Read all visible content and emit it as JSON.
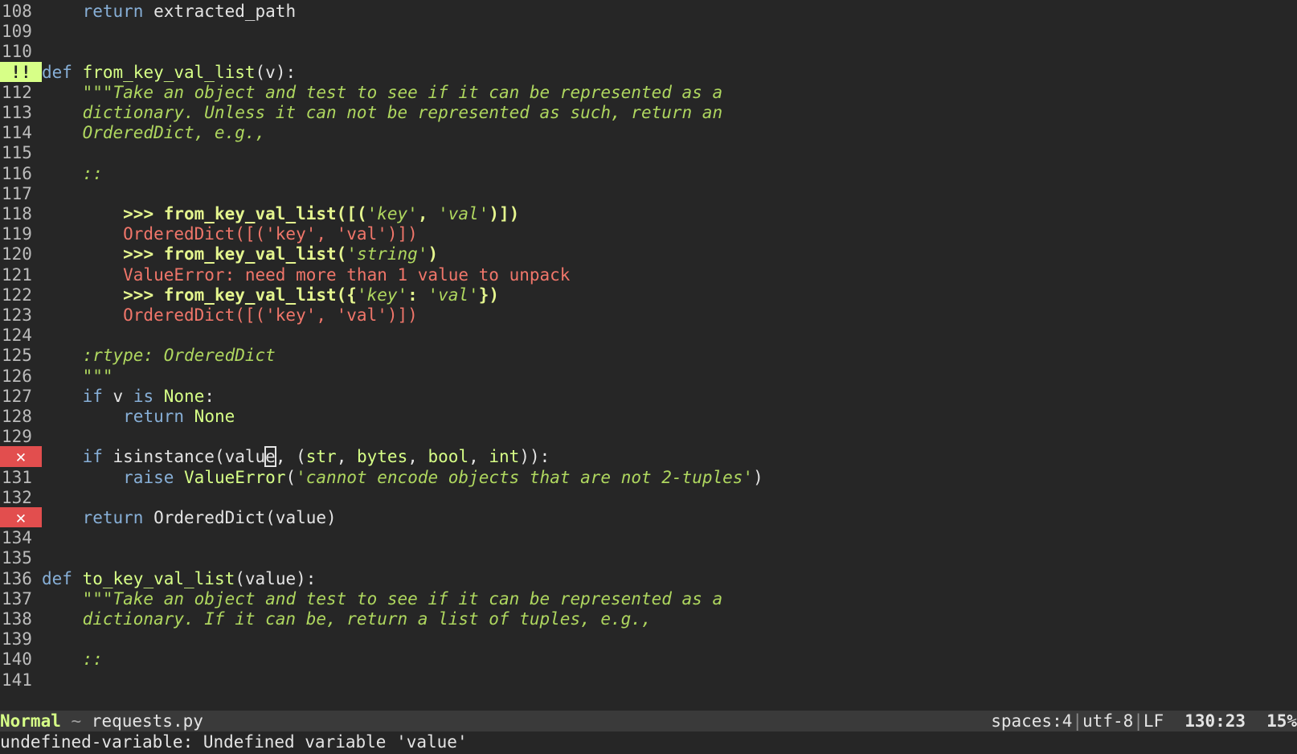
{
  "editor": {
    "lines": [
      {
        "num": "108",
        "marker": "",
        "segs": [
          [
            "plain",
            "    "
          ],
          [
            "kw",
            "return"
          ],
          [
            "plain",
            " extracted_path"
          ]
        ]
      },
      {
        "num": "109",
        "marker": "",
        "segs": []
      },
      {
        "num": "110",
        "marker": "",
        "segs": []
      },
      {
        "num": "111",
        "marker": "warn",
        "segs": [
          [
            "kw",
            "def"
          ],
          [
            "plain",
            " "
          ],
          [
            "fn",
            "from_key_val_list"
          ],
          [
            "plain",
            "(v):"
          ]
        ]
      },
      {
        "num": "112",
        "marker": "",
        "segs": [
          [
            "plain",
            "    "
          ],
          [
            "doc",
            "\"\"\"Take an object and test to see if it can be represented as a"
          ]
        ]
      },
      {
        "num": "113",
        "marker": "",
        "segs": [
          [
            "doc",
            "    dictionary. Unless it can not be represented as such, return an"
          ]
        ]
      },
      {
        "num": "114",
        "marker": "",
        "segs": [
          [
            "doc",
            "    OrderedDict, e.g.,"
          ]
        ]
      },
      {
        "num": "115",
        "marker": "",
        "segs": []
      },
      {
        "num": "116",
        "marker": "",
        "segs": [
          [
            "doc",
            "    ::"
          ]
        ]
      },
      {
        "num": "117",
        "marker": "",
        "segs": []
      },
      {
        "num": "118",
        "marker": "",
        "segs": [
          [
            "plain",
            "        "
          ],
          [
            "doctest",
            ">>> from_key_val_list([("
          ],
          [
            "dstr",
            "'key'"
          ],
          [
            "doctest",
            ", "
          ],
          [
            "dstr",
            "'val'"
          ],
          [
            "doctest",
            ")])"
          ]
        ]
      },
      {
        "num": "119",
        "marker": "",
        "segs": [
          [
            "out",
            "        OrderedDict([('key', 'val')])"
          ]
        ]
      },
      {
        "num": "120",
        "marker": "",
        "segs": [
          [
            "plain",
            "        "
          ],
          [
            "doctest",
            ">>> from_key_val_list("
          ],
          [
            "dstr",
            "'string'"
          ],
          [
            "doctest",
            ")"
          ]
        ]
      },
      {
        "num": "121",
        "marker": "",
        "segs": [
          [
            "out",
            "        ValueError: need more than 1 value to unpack"
          ]
        ]
      },
      {
        "num": "122",
        "marker": "",
        "segs": [
          [
            "plain",
            "        "
          ],
          [
            "doctest",
            ">>> from_key_val_list({"
          ],
          [
            "dstr",
            "'key'"
          ],
          [
            "doctest",
            ": "
          ],
          [
            "dstr",
            "'val'"
          ],
          [
            "doctest",
            "})"
          ]
        ]
      },
      {
        "num": "123",
        "marker": "",
        "segs": [
          [
            "out",
            "        OrderedDict([('key', 'val')])"
          ]
        ]
      },
      {
        "num": "124",
        "marker": "",
        "segs": []
      },
      {
        "num": "125",
        "marker": "",
        "segs": [
          [
            "doc",
            "    :rtype: OrderedDict"
          ]
        ]
      },
      {
        "num": "126",
        "marker": "",
        "segs": [
          [
            "doc",
            "    \"\"\""
          ]
        ]
      },
      {
        "num": "127",
        "marker": "",
        "segs": [
          [
            "plain",
            "    "
          ],
          [
            "kw",
            "if"
          ],
          [
            "plain",
            " v "
          ],
          [
            "kw",
            "is"
          ],
          [
            "plain",
            " "
          ],
          [
            "bi",
            "None"
          ],
          [
            "plain",
            ":"
          ]
        ]
      },
      {
        "num": "128",
        "marker": "",
        "segs": [
          [
            "plain",
            "        "
          ],
          [
            "kw",
            "return"
          ],
          [
            "plain",
            " "
          ],
          [
            "bi",
            "None"
          ]
        ]
      },
      {
        "num": "129",
        "marker": "",
        "segs": []
      },
      {
        "num": "130",
        "marker": "err",
        "segs": [
          [
            "plain",
            "    "
          ],
          [
            "kw",
            "if"
          ],
          [
            "plain",
            " isinstance(valu"
          ],
          [
            "cursor",
            "e"
          ],
          [
            "plain",
            ", ("
          ],
          [
            "bi",
            "str"
          ],
          [
            "plain",
            ", "
          ],
          [
            "bi",
            "bytes"
          ],
          [
            "plain",
            ", "
          ],
          [
            "bi",
            "bool"
          ],
          [
            "plain",
            ", "
          ],
          [
            "bi",
            "int"
          ],
          [
            "plain",
            ")):"
          ]
        ]
      },
      {
        "num": "131",
        "marker": "",
        "segs": [
          [
            "plain",
            "        "
          ],
          [
            "kw",
            "raise"
          ],
          [
            "plain",
            " "
          ],
          [
            "bi",
            "ValueError"
          ],
          [
            "plain",
            "("
          ],
          [
            "str",
            "'cannot encode objects that are not 2-tuples'"
          ],
          [
            "plain",
            ")"
          ]
        ]
      },
      {
        "num": "132",
        "marker": "",
        "segs": []
      },
      {
        "num": "133",
        "marker": "err",
        "segs": [
          [
            "plain",
            "    "
          ],
          [
            "kw",
            "return"
          ],
          [
            "plain",
            " OrderedDict(value)"
          ]
        ]
      },
      {
        "num": "134",
        "marker": "",
        "segs": []
      },
      {
        "num": "135",
        "marker": "",
        "segs": []
      },
      {
        "num": "136",
        "marker": "",
        "segs": [
          [
            "kw",
            "def"
          ],
          [
            "plain",
            " "
          ],
          [
            "fn",
            "to_key_val_list"
          ],
          [
            "plain",
            "(value):"
          ]
        ]
      },
      {
        "num": "137",
        "marker": "",
        "segs": [
          [
            "plain",
            "    "
          ],
          [
            "doc",
            "\"\"\"Take an object and test to see if it can be represented as a"
          ]
        ]
      },
      {
        "num": "138",
        "marker": "",
        "segs": [
          [
            "doc",
            "    dictionary. If it can be, return a list of tuples, e.g.,"
          ]
        ]
      },
      {
        "num": "139",
        "marker": "",
        "segs": []
      },
      {
        "num": "140",
        "marker": "",
        "segs": [
          [
            "doc",
            "    ::"
          ]
        ]
      },
      {
        "num": "141",
        "marker": "",
        "segs": []
      }
    ],
    "markers": {
      "warn": "!!",
      "err": "✕"
    }
  },
  "statusbar": {
    "mode": "Normal",
    "separator": " ~ ",
    "filename": "requests.py",
    "indent": "spaces:4",
    "encoding": "utf-8",
    "line_ending": "LF",
    "position": "130:23",
    "percent": "15%"
  },
  "cmdline": {
    "message": "undefined-variable: Undefined variable 'value'"
  },
  "colors": {
    "background": "#262626",
    "keyword": "#87afd7",
    "function": "#d7ff87",
    "docstring": "#afd75f",
    "doctest_output": "#f0766a",
    "warning_marker": "#d7ff87",
    "error_marker": "#e24e4e"
  }
}
